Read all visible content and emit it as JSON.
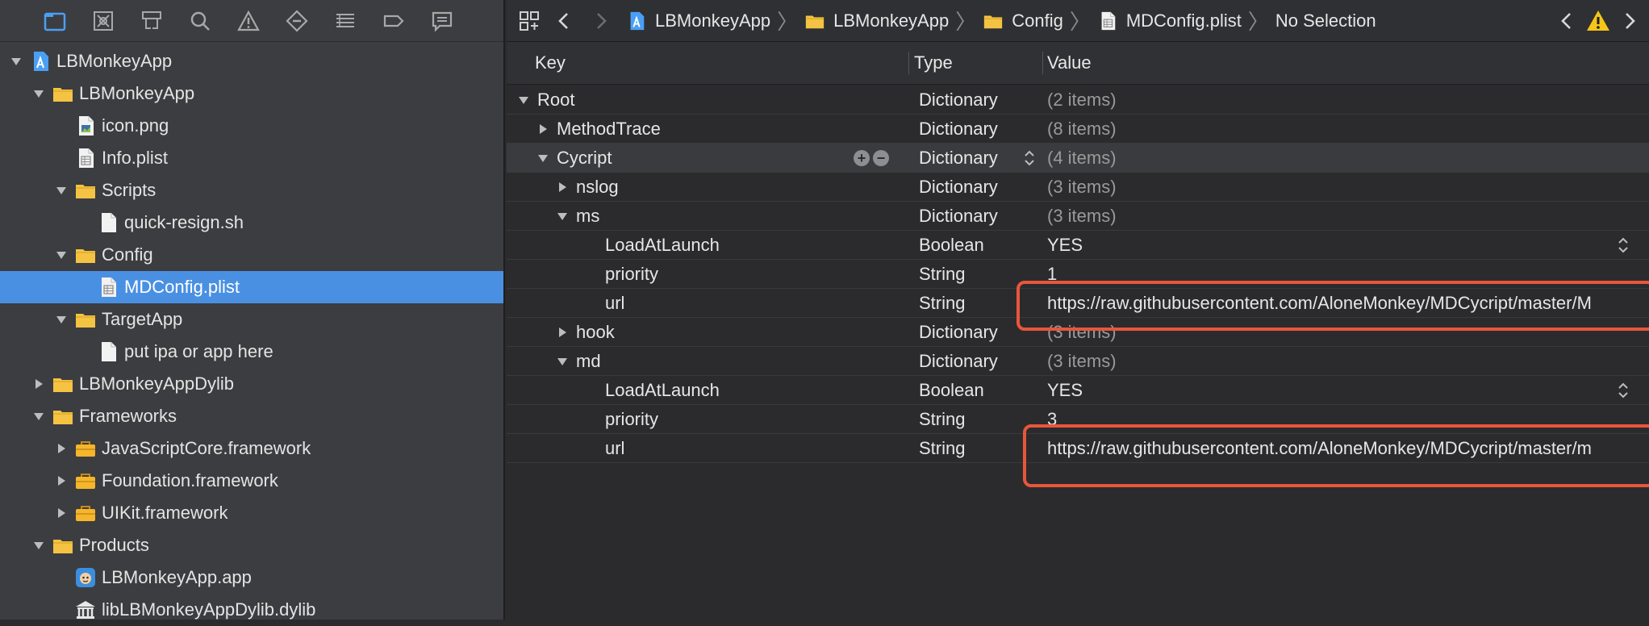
{
  "navigator": {
    "toolbar": [
      "project-navigator-icon",
      "source-control-icon",
      "symbol-navigator-icon",
      "find-icon",
      "issue-icon",
      "test-icon",
      "debug-icon",
      "breakpoint-icon",
      "report-icon"
    ],
    "tree": [
      {
        "label": "LBMonkeyApp",
        "level": 0,
        "expanded": true,
        "icon": "project",
        "disclosure": true
      },
      {
        "label": "LBMonkeyApp",
        "level": 1,
        "expanded": true,
        "icon": "folder",
        "disclosure": true
      },
      {
        "label": "icon.png",
        "level": 2,
        "icon": "image-file",
        "disclosure": false
      },
      {
        "label": "Info.plist",
        "level": 2,
        "icon": "plist-file",
        "disclosure": false
      },
      {
        "label": "Scripts",
        "level": 2,
        "expanded": true,
        "icon": "folder",
        "disclosure": true
      },
      {
        "label": "quick-resign.sh",
        "level": 3,
        "icon": "file",
        "disclosure": false
      },
      {
        "label": "Config",
        "level": 2,
        "expanded": true,
        "icon": "folder",
        "disclosure": true
      },
      {
        "label": "MDConfig.plist",
        "level": 3,
        "icon": "plist-file",
        "disclosure": false,
        "selected": true
      },
      {
        "label": "TargetApp",
        "level": 2,
        "expanded": true,
        "icon": "folder",
        "disclosure": true
      },
      {
        "label": "put ipa or app here",
        "level": 3,
        "icon": "file",
        "disclosure": false
      },
      {
        "label": "LBMonkeyAppDylib",
        "level": 1,
        "expanded": false,
        "icon": "folder",
        "disclosure": true
      },
      {
        "label": "Frameworks",
        "level": 1,
        "expanded": true,
        "icon": "folder",
        "disclosure": true
      },
      {
        "label": "JavaScriptCore.framework",
        "level": 2,
        "expanded": false,
        "icon": "framework",
        "disclosure": true
      },
      {
        "label": "Foundation.framework",
        "level": 2,
        "expanded": false,
        "icon": "framework",
        "disclosure": true
      },
      {
        "label": "UIKit.framework",
        "level": 2,
        "expanded": false,
        "icon": "framework",
        "disclosure": true
      },
      {
        "label": "Products",
        "level": 1,
        "expanded": true,
        "icon": "folder",
        "disclosure": true
      },
      {
        "label": "LBMonkeyApp.app",
        "level": 2,
        "icon": "app",
        "disclosure": false
      },
      {
        "label": "libLBMonkeyAppDylib.dylib",
        "level": 2,
        "icon": "library",
        "disclosure": false
      }
    ]
  },
  "jumpbar": {
    "crumbs": [
      {
        "label": "LBMonkeyApp",
        "icon": "project"
      },
      {
        "label": "LBMonkeyApp",
        "icon": "folder"
      },
      {
        "label": "Config",
        "icon": "folder"
      },
      {
        "label": "MDConfig.plist",
        "icon": "plist-file"
      },
      {
        "label": "No Selection",
        "icon": ""
      }
    ]
  },
  "plist": {
    "headers": {
      "key": "Key",
      "type": "Type",
      "value": "Value"
    },
    "rows": [
      {
        "key": "Root",
        "type": "Dictionary",
        "value": "(2 items)",
        "level": 0,
        "disclosure": "open",
        "dim": true
      },
      {
        "key": "MethodTrace",
        "type": "Dictionary",
        "value": "(8 items)",
        "level": 1,
        "disclosure": "closed",
        "dim": true
      },
      {
        "key": "Cycript",
        "type": "Dictionary",
        "value": "(4 items)",
        "level": 1,
        "disclosure": "open",
        "dim": true,
        "selected": true
      },
      {
        "key": "nslog",
        "type": "Dictionary",
        "value": "(3 items)",
        "level": 2,
        "disclosure": "closed",
        "dim": true
      },
      {
        "key": "ms",
        "type": "Dictionary",
        "value": "(3 items)",
        "level": 2,
        "disclosure": "open",
        "dim": true
      },
      {
        "key": "LoadAtLaunch",
        "type": "Boolean",
        "value": "YES",
        "level": 3,
        "disclosure": "none",
        "stepper": true
      },
      {
        "key": "priority",
        "type": "String",
        "value": "1",
        "level": 3,
        "disclosure": "none"
      },
      {
        "key": "url",
        "type": "String",
        "value": "https://raw.githubusercontent.com/AloneMonkey/MDCycript/master/M",
        "level": 3,
        "disclosure": "none"
      },
      {
        "key": "hook",
        "type": "Dictionary",
        "value": "(3 items)",
        "level": 2,
        "disclosure": "closed",
        "dim": true
      },
      {
        "key": "md",
        "type": "Dictionary",
        "value": "(3 items)",
        "level": 2,
        "disclosure": "open",
        "dim": true
      },
      {
        "key": "LoadAtLaunch",
        "type": "Boolean",
        "value": "YES",
        "level": 3,
        "disclosure": "none",
        "stepper": true
      },
      {
        "key": "priority",
        "type": "String",
        "value": "3",
        "level": 3,
        "disclosure": "none"
      },
      {
        "key": "url",
        "type": "String",
        "value": "https://raw.githubusercontent.com/AloneMonkey/MDCycript/master/m",
        "level": 3,
        "disclosure": "none"
      }
    ]
  },
  "colors": {
    "selection": "#4a90e2",
    "highlight": "#e8563b",
    "folder": "#f5c343",
    "warning": "#f5c518"
  }
}
